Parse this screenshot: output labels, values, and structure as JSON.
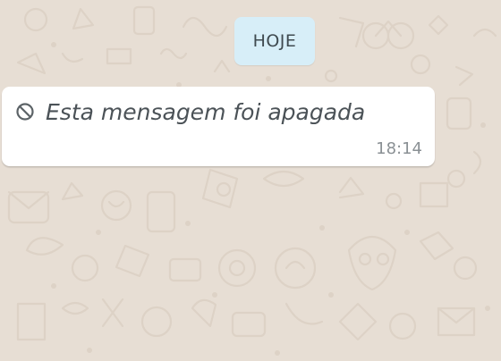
{
  "chat": {
    "date_chip": "HOJE",
    "message": {
      "text": "Esta mensagem foi apagada",
      "time": "18:14",
      "icon": "deleted-message-icon"
    }
  },
  "colors": {
    "wallpaper": "#e7ded4",
    "date_chip_bg": "#d7eef8",
    "bubble_bg": "#ffffff",
    "deleted_text": "#4b5257",
    "timestamp": "#8a9094"
  }
}
